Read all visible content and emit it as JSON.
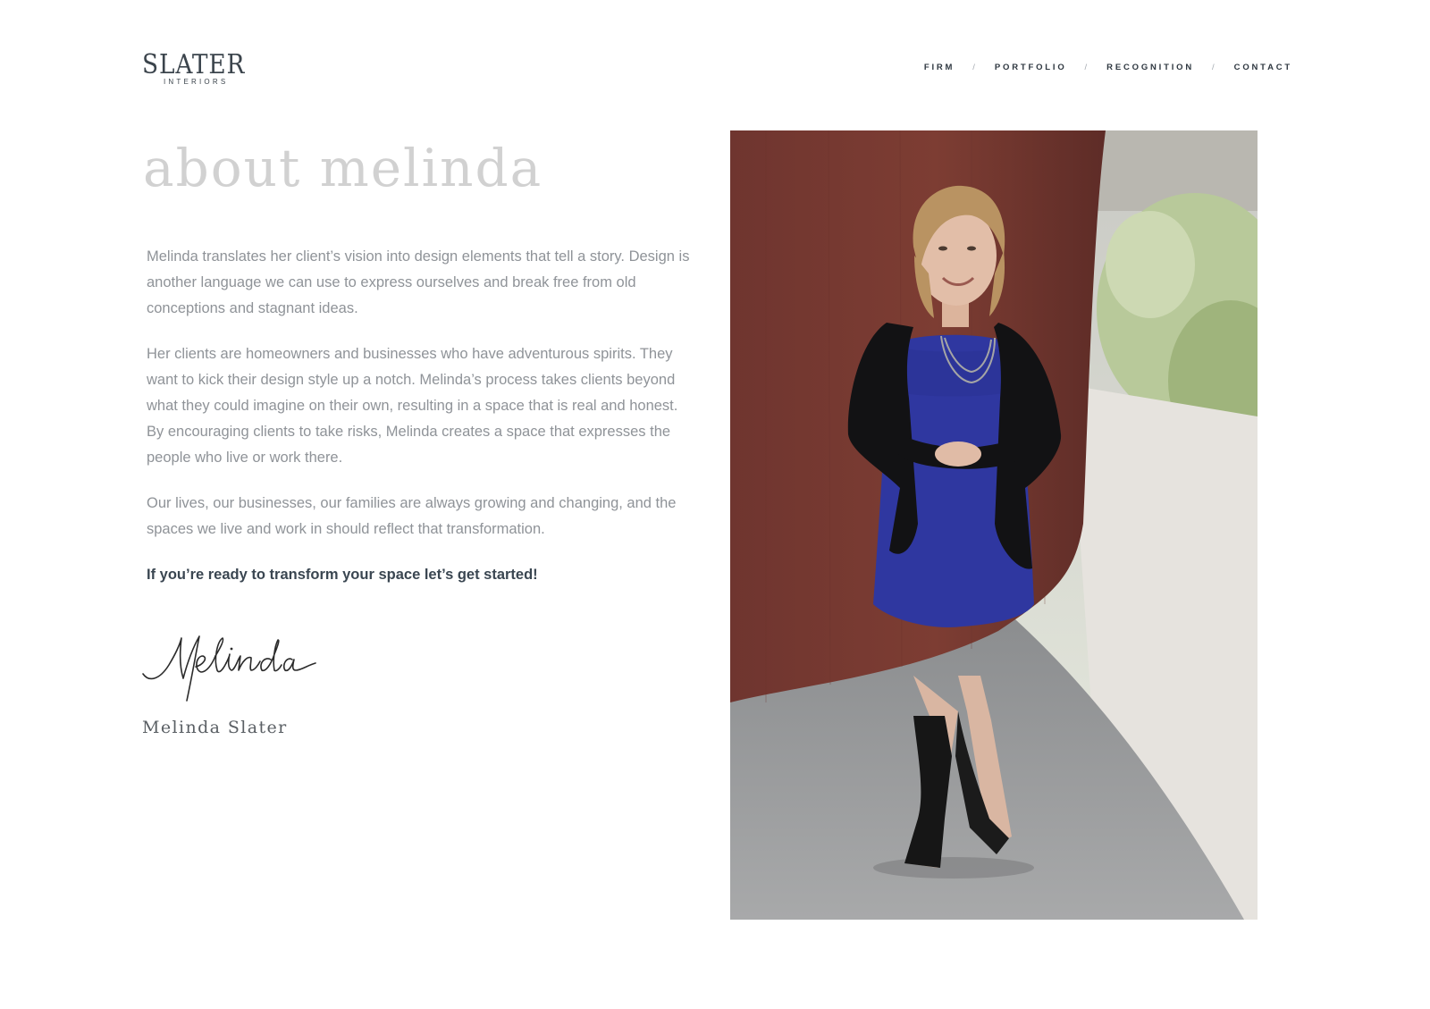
{
  "brand": {
    "name": "SLATER",
    "tagline": "INTERIORS"
  },
  "nav": {
    "items": [
      {
        "label": "FIRM"
      },
      {
        "label": "PORTFOLIO"
      },
      {
        "label": "RECOGNITION"
      },
      {
        "label": "CONTACT"
      }
    ],
    "separator": "/"
  },
  "main": {
    "heading": "about melinda",
    "paragraphs": [
      "Melinda translates her client’s vision into design elements that tell a story. Design is another language we can use to express ourselves and break free from old conceptions and stagnant ideas.",
      "Her clients are homeowners and businesses who have adventurous spirits. They want to kick their design style up a notch. Melinda’s process takes clients beyond what they could imagine on their own, resulting in a space that is real and honest. By encouraging clients to take risks, Melinda creates a space that expresses the people who live or work there.",
      "Our lives, our businesses, our families are always growing and changing, and the spaces we live and work in should reflect that transformation."
    ],
    "call_to_action": "If you’re ready to transform your space let’s get started!",
    "signature_text": "Melinda",
    "signature_name": "Melinda Slater"
  },
  "colors": {
    "heading": "#d1d1d1",
    "body_text": "#8f9398",
    "cta_text": "#3a4651",
    "nav_text": "#2e3740",
    "dress_blue": "#2f37a0",
    "wall_rust": "#7a3a32"
  }
}
